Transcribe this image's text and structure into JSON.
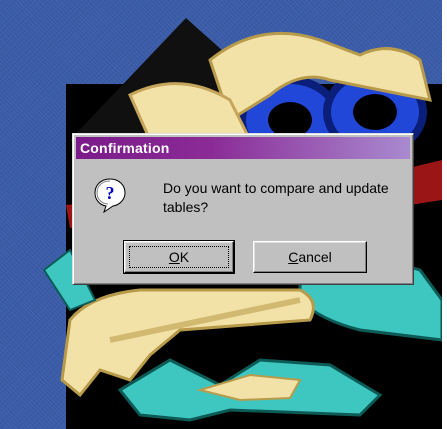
{
  "dialog": {
    "title": "Confirmation",
    "message": "Do you want to compare and update tables?",
    "icon": "question-icon",
    "buttons": {
      "ok": {
        "mnemonic": "O",
        "rest": "K"
      },
      "cancel": {
        "mnemonic": "C",
        "rest": "ancel"
      }
    }
  },
  "background": {
    "description_colors": {
      "desktop": "#3a5ba8",
      "panel": "#000000",
      "gold": "#f2e0a0",
      "teal": "#3ec7c0",
      "blue": "#2a4de0"
    }
  }
}
